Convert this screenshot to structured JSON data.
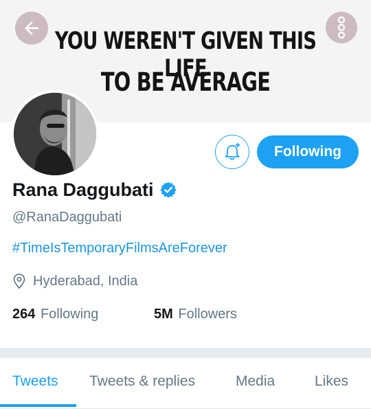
{
  "banner": {
    "line1": "YOU WEREN'T GIVEN THIS LIFE",
    "line2": "TO BE AVERAGE"
  },
  "icons": {
    "back": "arrow-left-icon",
    "more": "more-vertical-icon",
    "bell": "notification-bell-add-icon",
    "verified": "verified-badge-icon",
    "location": "location-pin-icon"
  },
  "profile": {
    "name": "Rana Daggubati",
    "handle": "@RanaDaggubati",
    "bio_hashtag": "#TimeIsTemporaryFilmsAreForever",
    "location": "Hyderabad, India",
    "verified": true
  },
  "actions": {
    "follow_state_label": "Following"
  },
  "stats": {
    "following_count": "264",
    "following_label": "Following",
    "followers_count": "5M",
    "followers_label": "Followers"
  },
  "tabs": [
    {
      "label": "Tweets",
      "active": true
    },
    {
      "label": "Tweets & replies",
      "active": false
    },
    {
      "label": "Media",
      "active": false
    },
    {
      "label": "Likes",
      "active": false
    }
  ],
  "colors": {
    "accent": "#1da1f2",
    "hashtag": "#1b95e0",
    "secondary_text": "#657786",
    "primary_text": "#14171a"
  }
}
